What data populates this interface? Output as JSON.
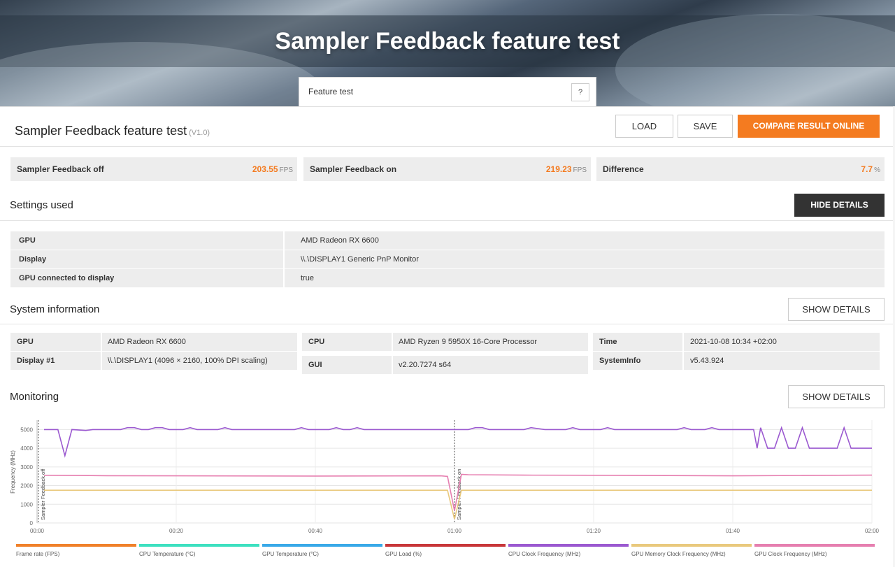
{
  "hero": {
    "title": "Sampler Feedback feature test"
  },
  "tab": {
    "label": "Feature test",
    "help": "?"
  },
  "result": {
    "title": "Sampler Feedback feature test",
    "version": "(V1.0)",
    "load_label": "LOAD",
    "save_label": "SAVE",
    "compare_label": "COMPARE RESULT ONLINE"
  },
  "scores": [
    {
      "name": "Sampler Feedback off",
      "value": "203.55",
      "unit": "FPS"
    },
    {
      "name": "Sampler Feedback on",
      "value": "219.23",
      "unit": "FPS"
    },
    {
      "name": "Difference",
      "value": "7.7",
      "unit": "%"
    }
  ],
  "settings": {
    "title": "Settings used",
    "button": "HIDE DETAILS",
    "rows": [
      {
        "key": "GPU",
        "value": "AMD Radeon RX 6600"
      },
      {
        "key": "Display",
        "value": "\\\\.\\DISPLAY1 Generic PnP Monitor"
      },
      {
        "key": "GPU connected to display",
        "value": "true"
      }
    ]
  },
  "system": {
    "title": "System information",
    "button": "SHOW DETAILS",
    "gpu_key": "GPU",
    "gpu_val": "AMD Radeon RX 6600",
    "display_key": "Display #1",
    "display_val": "\\\\.\\DISPLAY1 (4096 × 2160, 100% DPI scaling)",
    "cpu_key": "CPU",
    "cpu_val": "AMD Ryzen 9 5950X 16-Core Processor",
    "gui_key": "GUI",
    "gui_val": "v2.20.7274 s64",
    "time_key": "Time",
    "time_val": "2021-10-08 10:34 +02:00",
    "sysinfo_key": "SystemInfo",
    "sysinfo_val": "v5.43.924"
  },
  "monitoring": {
    "title": "Monitoring",
    "button": "SHOW DETAILS"
  },
  "chart_data": {
    "type": "line",
    "ylabel": "Frequency (MHz)",
    "ylim": [
      0,
      5500
    ],
    "yticks": [
      "0",
      "1000",
      "2000",
      "3000",
      "4000",
      "5000"
    ],
    "xlim": [
      0,
      120
    ],
    "xticks": [
      "00:00",
      "00:20",
      "00:40",
      "01:00",
      "01:20",
      "01:40",
      "02:00"
    ],
    "markers": [
      {
        "label": "Sampler Feedback off",
        "x": 0.2
      },
      {
        "label": "Sampler Feedback on",
        "x": 60
      }
    ],
    "legend": [
      {
        "name": "Frame rate (FPS)",
        "color": "#f0812a"
      },
      {
        "name": "CPU Temperature (°C)",
        "color": "#3de0c0"
      },
      {
        "name": "GPU Temperature (°C)",
        "color": "#39a9e8"
      },
      {
        "name": "GPU Load (%)",
        "color": "#c8373a"
      },
      {
        "name": "CPU Clock Frequency (MHz)",
        "color": "#9b59d0"
      },
      {
        "name": "GPU Memory Clock Frequency (MHz)",
        "color": "#e9c97d"
      },
      {
        "name": "GPU Clock Frequency (MHz)",
        "color": "#e67fb0"
      }
    ],
    "series": [
      {
        "name": "CPU Clock Frequency (MHz)",
        "color": "#9b59d0",
        "points": [
          [
            1,
            5000
          ],
          [
            3,
            5000
          ],
          [
            4,
            3600
          ],
          [
            5,
            5000
          ],
          [
            7,
            4950
          ],
          [
            8,
            5000
          ],
          [
            12,
            5000
          ],
          [
            13,
            5100
          ],
          [
            14,
            5100
          ],
          [
            15,
            5000
          ],
          [
            16,
            5000
          ],
          [
            17,
            5100
          ],
          [
            18,
            5100
          ],
          [
            19,
            5000
          ],
          [
            21,
            5000
          ],
          [
            22,
            5100
          ],
          [
            23,
            5000
          ],
          [
            26,
            5000
          ],
          [
            27,
            5100
          ],
          [
            28,
            5000
          ],
          [
            37,
            5000
          ],
          [
            38,
            5100
          ],
          [
            39,
            5000
          ],
          [
            42,
            5000
          ],
          [
            43,
            5100
          ],
          [
            44,
            5000
          ],
          [
            45,
            5000
          ],
          [
            46,
            5100
          ],
          [
            47,
            5000
          ],
          [
            60,
            5000
          ],
          [
            62,
            5000
          ],
          [
            63,
            5100
          ],
          [
            64,
            5100
          ],
          [
            65,
            5000
          ],
          [
            70,
            5000
          ],
          [
            71,
            5100
          ],
          [
            73,
            5000
          ],
          [
            76,
            5000
          ],
          [
            77,
            5100
          ],
          [
            78,
            5000
          ],
          [
            81,
            5000
          ],
          [
            82,
            5100
          ],
          [
            83,
            5000
          ],
          [
            92,
            5000
          ],
          [
            93,
            5100
          ],
          [
            94,
            5000
          ],
          [
            96,
            5000
          ],
          [
            97,
            5100
          ],
          [
            98,
            5000
          ],
          [
            100,
            5000
          ],
          [
            101,
            5000
          ],
          [
            103,
            5000
          ],
          [
            103.5,
            4000
          ],
          [
            104,
            5100
          ],
          [
            105,
            4000
          ],
          [
            106,
            4000
          ],
          [
            107,
            5100
          ],
          [
            108,
            4000
          ],
          [
            109,
            4000
          ],
          [
            110,
            5100
          ],
          [
            111,
            4000
          ],
          [
            115,
            4000
          ],
          [
            116,
            5100
          ],
          [
            117,
            4000
          ],
          [
            120,
            4000
          ]
        ]
      },
      {
        "name": "GPU Clock Frequency (MHz)",
        "color": "#e67fb0",
        "points": [
          [
            1,
            2550
          ],
          [
            10,
            2530
          ],
          [
            20,
            2520
          ],
          [
            40,
            2510
          ],
          [
            58,
            2520
          ],
          [
            59,
            2490
          ],
          [
            60,
            650
          ],
          [
            61,
            2600
          ],
          [
            62,
            2580
          ],
          [
            70,
            2560
          ],
          [
            80,
            2550
          ],
          [
            100,
            2520
          ],
          [
            110,
            2540
          ],
          [
            120,
            2560
          ]
        ]
      },
      {
        "name": "GPU Memory Clock Frequency (MHz)",
        "color": "#e9c97d",
        "points": [
          [
            1,
            1750
          ],
          [
            59,
            1750
          ],
          [
            60,
            200
          ],
          [
            61,
            1750
          ],
          [
            120,
            1750
          ]
        ]
      }
    ]
  }
}
